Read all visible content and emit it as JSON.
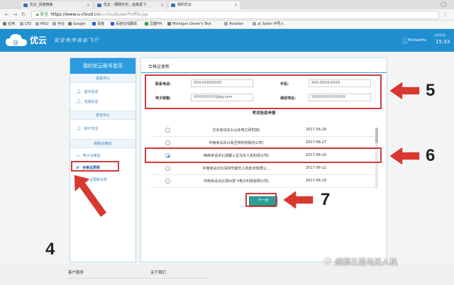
{
  "browser": {
    "tabs": [
      {
        "title": "优云_百度搜索"
      },
      {
        "title": "优云 - 翱翔天空，远离黑飞"
      },
      {
        "title": "我的优云"
      }
    ],
    "address": {
      "secure_label": "安全",
      "url_domain": "https://www.u-cloud.cn",
      "url_path": "/u-cloud/userProfile.jsp"
    },
    "bookmarks": [
      {
        "label": "应用"
      },
      {
        "label": "LTD"
      },
      {
        "label": "MSU"
      },
      {
        "label": "作业"
      },
      {
        "label": "Google"
      },
      {
        "label": "百度"
      },
      {
        "label": "百度在线翻译"
      },
      {
        "label": "豆瓣FM"
      },
      {
        "label": "Michigan Driver's Test"
      },
      {
        "label": "Aviation"
      },
      {
        "label": "从 Safari 中导入"
      }
    ]
  },
  "header": {
    "logo_text": "优云",
    "slogan": "安全有序自由飞行",
    "username": "MichaelHu",
    "date_label": "北京时间",
    "time": "15:33"
  },
  "sidebar": {
    "title": "我的优云账号首页",
    "sections": [
      {
        "label": "信息中心",
        "items": [
          {
            "label": "基本信息",
            "icon": "user-icon"
          },
          {
            "label": "完成信息",
            "icon": "user-icon"
          }
        ]
      },
      {
        "label": "安全中心",
        "items": [
          {
            "label": "账户安全",
            "icon": "person-icon"
          }
        ]
      },
      {
        "label": "我的合格证",
        "items": [
          {
            "label": "电子合格证",
            "icon": "card-icon"
          },
          {
            "label": "合格证更新",
            "icon": "refresh-icon"
          },
          {
            "label": "合格证更新记录",
            "icon": "list-icon"
          }
        ]
      }
    ]
  },
  "main": {
    "title": "合格证更新",
    "fields": {
      "phone_label": "联系电话:",
      "phone_value": "XXX-XXXXXXXX",
      "mobile_label": "手机:",
      "mobile_value": "XXX-XXXX-XXXX",
      "email_label": "电子邮箱:",
      "email_value": "XXXXXXXXX@qq.com",
      "address_label": "通信地址:",
      "address_value": "XXXXXXXXXXXXXX"
    },
    "exam_title": "考试信息申报",
    "exams": [
      {
        "name": "华东考试点1(山东电力研究院)",
        "date": "2017-06-29",
        "selected": false
      },
      {
        "name": "中南考试点1(易互特科技股份公司)",
        "date": "2017-06-27",
        "selected": false
      },
      {
        "name": "西南考试点1(成都三足乌无人机科技公司)",
        "date": "2017-06-10",
        "selected": true
      },
      {
        "name": "中南考试点3(深圳华越无人机技术有限公...",
        "date": "2017-06-12",
        "selected": false
      },
      {
        "name": "中南考试点2(郑州技飞电子科技有限公司)",
        "date": "2017-06-18",
        "selected": false
      }
    ],
    "next_label": "下一步"
  },
  "annotations": {
    "n4": "4",
    "n5": "5",
    "n6": "6",
    "n7": "7",
    "color": "#d33a3a"
  },
  "footer": {
    "customer_service": "客户服务",
    "about": "关于我们"
  },
  "watermark": "成都三足乌无人机",
  "colors": {
    "brand_blue": "#1f8fd0",
    "next_button": "#2aa198"
  }
}
